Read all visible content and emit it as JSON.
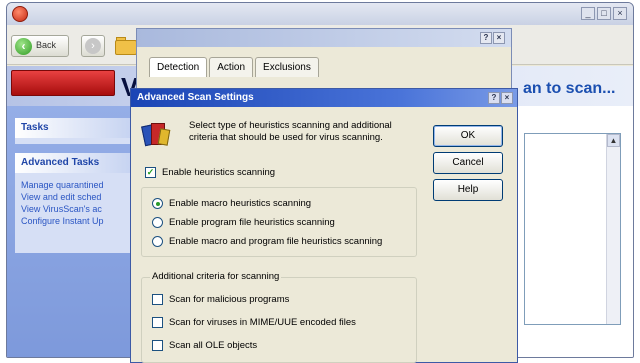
{
  "main_window": {
    "title": "",
    "toolbar": {
      "back_label": "Back",
      "fwd_glyph": "›",
      "back_glyph": "‹"
    },
    "banner": {
      "big_letter": "V",
      "heading_tail": "an to scan..."
    },
    "sidebar": {
      "tasks_header": "Tasks",
      "advanced_header": "Advanced Tasks",
      "advanced_links": [
        "Manage quarantined",
        "View and edit sched",
        "View VirusScan's ac",
        "Configure Instant Up"
      ]
    }
  },
  "mid_dialog": {
    "tabs": [
      "Detection",
      "Action",
      "Exclusions"
    ]
  },
  "adv_dialog": {
    "title": "Advanced Scan Settings",
    "description": "Select type of heuristics scanning and additional criteria that should be used for virus scanning.",
    "enable_heuristics": {
      "label": "Enable heuristics scanning",
      "checked": true
    },
    "heuristics_options": [
      {
        "label": "Enable macro heuristics scanning",
        "selected": true
      },
      {
        "label": "Enable program file heuristics scanning",
        "selected": false
      },
      {
        "label": "Enable macro and program file heuristics scanning",
        "selected": false
      }
    ],
    "additional_group_label": "Additional criteria for scanning",
    "additional_criteria": [
      {
        "label": "Scan for malicious programs",
        "checked": false
      },
      {
        "label": "Scan for viruses in MIME/UUE encoded files",
        "checked": false
      },
      {
        "label": "Scan all OLE objects",
        "checked": false
      }
    ],
    "buttons": {
      "ok": "OK",
      "cancel": "Cancel",
      "help": "Help"
    },
    "win_buttons": {
      "help": "?",
      "close": "×"
    }
  },
  "colors": {
    "title_active": "#1b45b5",
    "logo_red": "#c41e1e",
    "link_blue": "#2a55c3",
    "heading_blue": "#1b4fb0"
  }
}
